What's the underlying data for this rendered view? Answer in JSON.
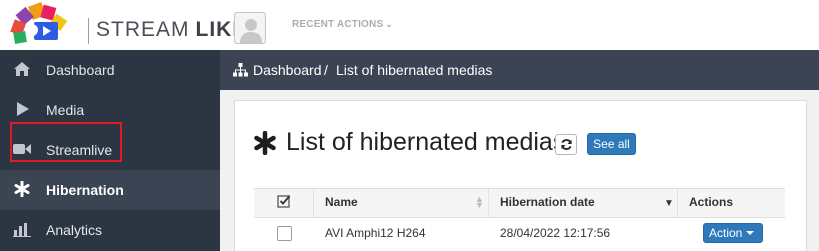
{
  "header": {
    "brand_light": "STREAM",
    "brand_bold": "LIKE",
    "recent_actions": "RECENT ACTIONS",
    "recent_icon": "chevron-down-icon"
  },
  "sidebar": {
    "items": [
      {
        "label": "Dashboard",
        "icon": "home-icon",
        "glyph": "⌂"
      },
      {
        "label": "Media",
        "icon": "play-icon",
        "glyph": "▶"
      },
      {
        "label": "Streamlive",
        "icon": "video-camera-icon",
        "glyph": "■"
      },
      {
        "label": "Hibernation",
        "icon": "asterisk-icon",
        "glyph": "✱",
        "active": true
      },
      {
        "label": "Analytics",
        "icon": "bar-chart-icon",
        "glyph": "▁"
      }
    ]
  },
  "breadcrumb": {
    "home": "Dashboard",
    "separator": "/",
    "current": "List of hibernated medias"
  },
  "panel": {
    "title": "List of hibernated medias",
    "see_all": "See all"
  },
  "table": {
    "headers": {
      "name": "Name",
      "hibernation_date": "Hibernation date",
      "actions": "Actions"
    },
    "rows": [
      {
        "name": "AVI Amphi12 H264",
        "hibernation_date": "28/04/2022 12:17:56",
        "action": "Action"
      }
    ]
  },
  "colors": {
    "sidebar_bg": "#2c3542",
    "breadcrumb_bg": "#3c4352",
    "primary_button": "#2e79b9",
    "highlight_box": "#e01b24"
  }
}
